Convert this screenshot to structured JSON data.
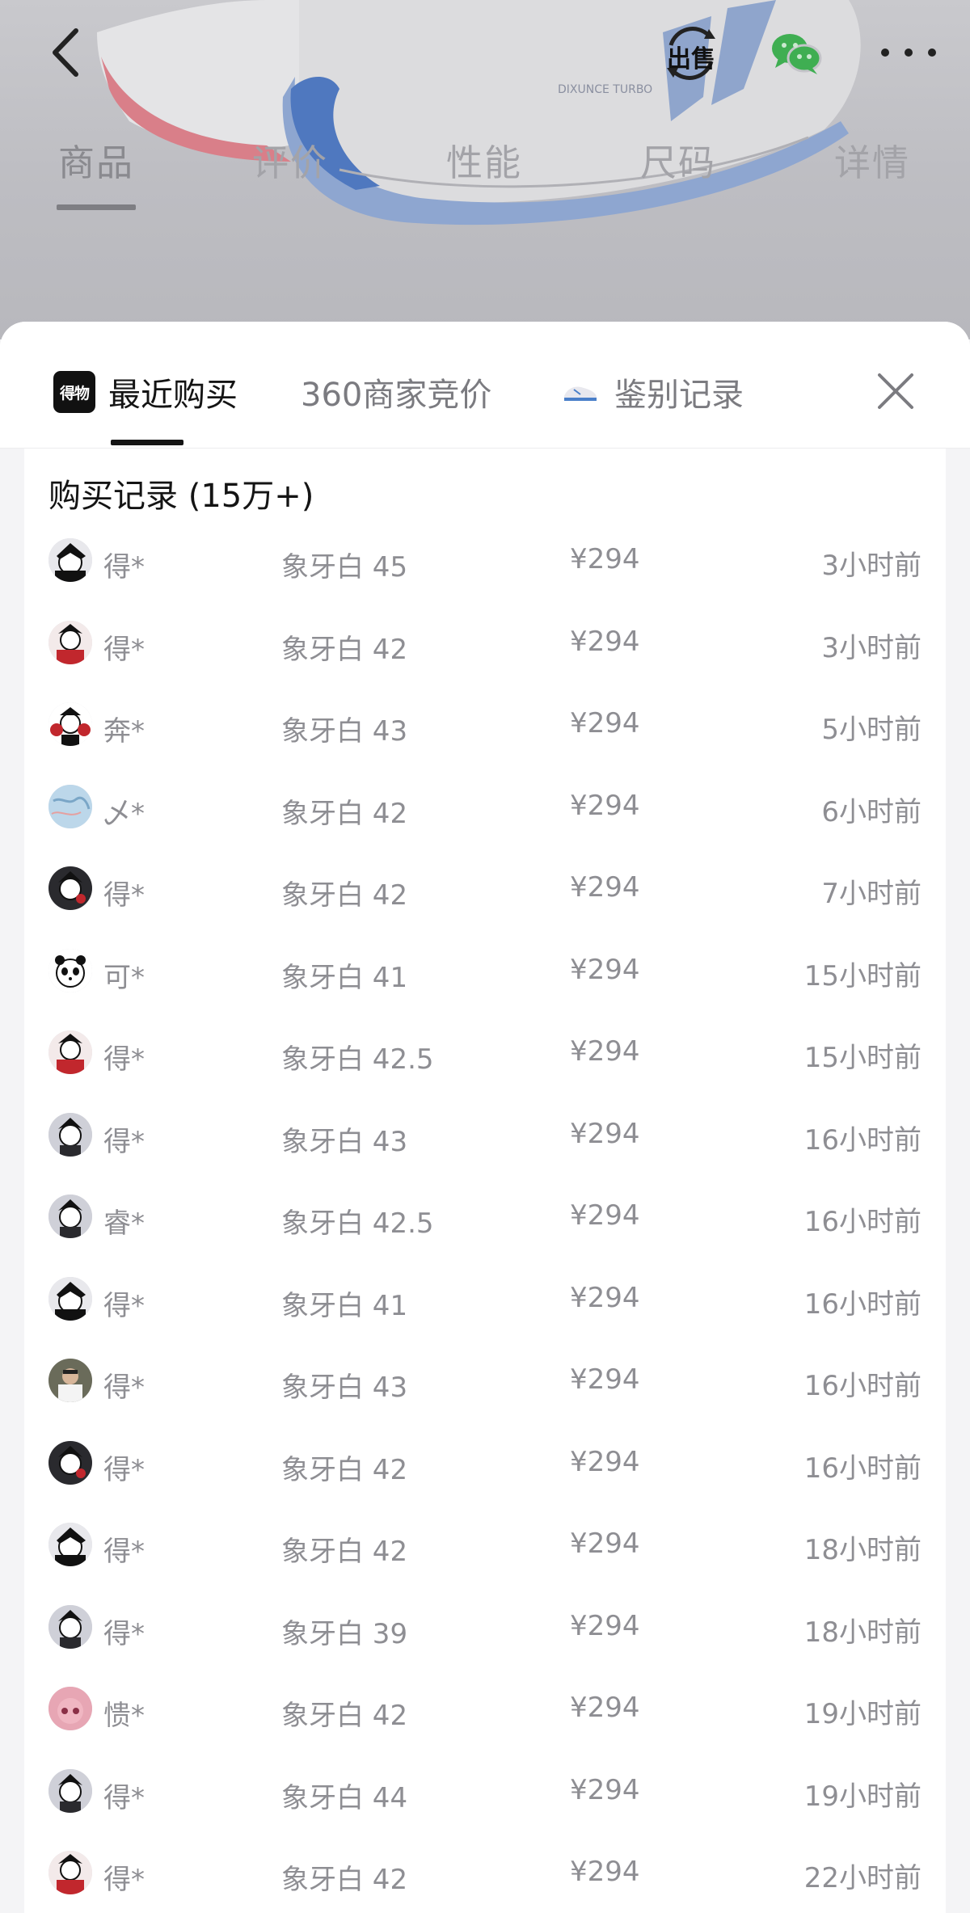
{
  "header": {
    "icons": [
      "back-icon",
      "sell-icon",
      "wechat-icon",
      "more-icon"
    ],
    "sell_label": "出售",
    "tabs": [
      "商品",
      "评价",
      "性能",
      "尺码",
      "详情"
    ],
    "active_tab": "商品",
    "shoe_label": "DIXUNCE TURBO"
  },
  "sheet": {
    "tabs": [
      {
        "label": "最近购买",
        "logo": "得物"
      },
      {
        "label": "360商家竞价"
      },
      {
        "label": "鉴别记录"
      }
    ],
    "active_tab": "最近购买",
    "records_title": "购买记录 (15万+)",
    "records": [
      {
        "buyer": "得*",
        "variant": "象牙白 45",
        "price": "¥294",
        "time": "3小时前",
        "avatar": "anime-boy"
      },
      {
        "buyer": "得*",
        "variant": "象牙白 42",
        "price": "¥294",
        "time": "3小时前",
        "avatar": "anime-red"
      },
      {
        "buyer": "奔*",
        "variant": "象牙白 43",
        "price": "¥294",
        "time": "5小时前",
        "avatar": "anime-boxer"
      },
      {
        "buyer": "乄*",
        "variant": "象牙白 42",
        "price": "¥294",
        "time": "6小时前",
        "avatar": "map"
      },
      {
        "buyer": "得*",
        "variant": "象牙白 42",
        "price": "¥294",
        "time": "7小时前",
        "avatar": "anime-dark"
      },
      {
        "buyer": "可*",
        "variant": "象牙白 41",
        "price": "¥294",
        "time": "15小时前",
        "avatar": "panda"
      },
      {
        "buyer": "得*",
        "variant": "象牙白 42.5",
        "price": "¥294",
        "time": "15小时前",
        "avatar": "anime-red"
      },
      {
        "buyer": "得*",
        "variant": "象牙白 43",
        "price": "¥294",
        "time": "16小时前",
        "avatar": "anime-grey"
      },
      {
        "buyer": "睿*",
        "variant": "象牙白 42.5",
        "price": "¥294",
        "time": "16小时前",
        "avatar": "anime-grey"
      },
      {
        "buyer": "得*",
        "variant": "象牙白 41",
        "price": "¥294",
        "time": "16小时前",
        "avatar": "anime-boy"
      },
      {
        "buyer": "得*",
        "variant": "象牙白 43",
        "price": "¥294",
        "time": "16小时前",
        "avatar": "photo"
      },
      {
        "buyer": "得*",
        "variant": "象牙白 42",
        "price": "¥294",
        "time": "16小时前",
        "avatar": "anime-dark"
      },
      {
        "buyer": "得*",
        "variant": "象牙白 42",
        "price": "¥294",
        "time": "18小时前",
        "avatar": "anime-boy"
      },
      {
        "buyer": "得*",
        "variant": "象牙白 39",
        "price": "¥294",
        "time": "18小时前",
        "avatar": "anime-grey"
      },
      {
        "buyer": "愦*",
        "variant": "象牙白 42",
        "price": "¥294",
        "time": "19小时前",
        "avatar": "pink"
      },
      {
        "buyer": "得*",
        "variant": "象牙白 44",
        "price": "¥294",
        "time": "19小时前",
        "avatar": "anime-grey"
      },
      {
        "buyer": "得*",
        "variant": "象牙白 42",
        "price": "¥294",
        "time": "22小时前",
        "avatar": "anime-red"
      }
    ]
  },
  "colors": {
    "overlay": "#bdbdc2",
    "text_primary": "#141414",
    "text_secondary": "#8e8e93",
    "wechat_green": "#2dbb4e"
  }
}
